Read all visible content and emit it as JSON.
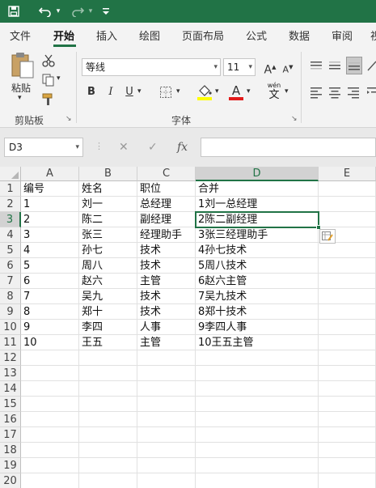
{
  "qat": {
    "save_icon": "save-icon",
    "undo_icon": "undo-icon",
    "redo_icon": "redo-icon",
    "customize_icon": "customize-qat-icon"
  },
  "tabs": [
    "文件",
    "开始",
    "插入",
    "绘图",
    "页面布局",
    "公式",
    "数据",
    "审阅",
    "视"
  ],
  "active_tab": "开始",
  "ribbon": {
    "clipboard": {
      "paste_label": "粘贴",
      "group_label": "剪贴板"
    },
    "font": {
      "font_name": "等线",
      "font_size": "11",
      "bold": "B",
      "italic": "I",
      "underline": "U",
      "font_color_label": "A",
      "phonetic_label": "wén",
      "group_label": "字体"
    }
  },
  "formula_bar": {
    "name_box": "D3",
    "cancel": "✕",
    "enter": "✓",
    "fx": "fx",
    "formula": ""
  },
  "sheet": {
    "columns": [
      "A",
      "B",
      "C",
      "D",
      "E"
    ],
    "rows": [
      "1",
      "2",
      "3",
      "4",
      "5",
      "6",
      "7",
      "8",
      "9",
      "10",
      "11",
      "12",
      "13",
      "14",
      "15",
      "16",
      "17",
      "18",
      "19",
      "20"
    ],
    "cells": [
      [
        "编号",
        "姓名",
        "职位",
        "合并"
      ],
      [
        "1",
        "刘一",
        "总经理",
        "1刘一总经理"
      ],
      [
        "2",
        "陈二",
        "副经理",
        "2陈二副经理"
      ],
      [
        "3",
        "张三",
        "经理助手",
        "3张三经理助手"
      ],
      [
        "4",
        "孙七",
        "技术",
        "4孙七技术"
      ],
      [
        "5",
        "周八",
        "技术",
        "5周八技术"
      ],
      [
        "6",
        "赵六",
        "主管",
        "6赵六主管"
      ],
      [
        "7",
        "吴九",
        "技术",
        "7吴九技术"
      ],
      [
        "8",
        "郑十",
        "技术",
        "8郑十技术"
      ],
      [
        "9",
        "李四",
        "人事",
        "9李四人事"
      ],
      [
        "10",
        "王五",
        "主管",
        "10王五主管"
      ]
    ],
    "selected_cell": "D3",
    "accent_color": "#217346"
  }
}
